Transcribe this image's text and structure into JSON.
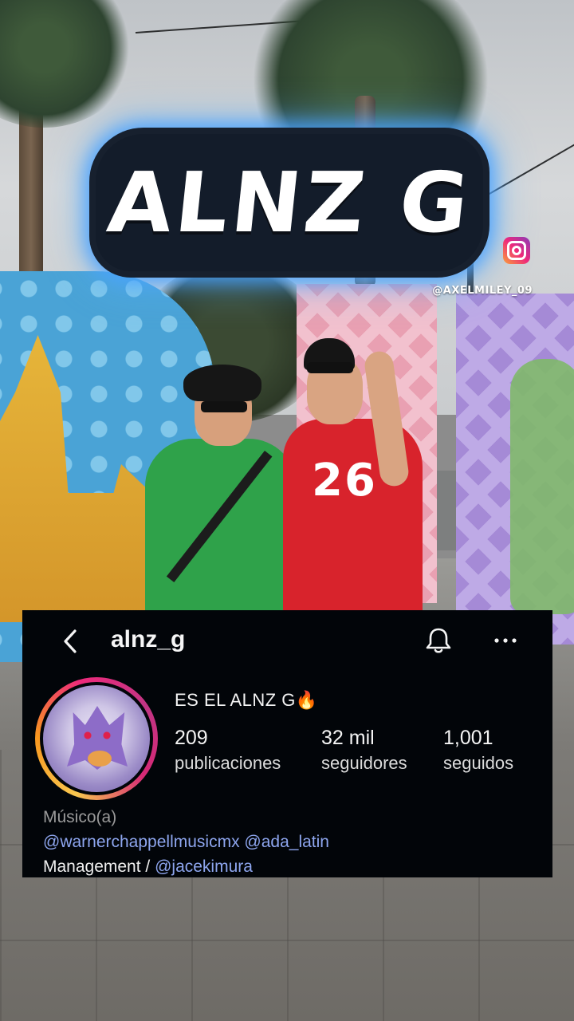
{
  "overlay": {
    "title": "ALNZ G",
    "watermark": "@AXELMILEY_09"
  },
  "shirt_number": "26",
  "profile": {
    "username": "alnz_g",
    "display_name": "ES EL ALNZ G🔥",
    "stats": {
      "posts": {
        "value": "209",
        "label": "publicaciones"
      },
      "followers": {
        "value": "32 mil",
        "label": "seguidores"
      },
      "following": {
        "value": "1,001",
        "label": "seguidos"
      }
    },
    "bio": {
      "category": "Músico(a)",
      "mention_1": "@warnerchappellmusicmx",
      "mention_2": "@ada_latin",
      "line3_prefix": "Management / ",
      "mention_3": "@jacekimura"
    }
  },
  "icons": {
    "back": "chevron-left-icon",
    "notifications": "bell-icon",
    "more": "more-horizontal-icon",
    "instagram": "instagram-icon"
  },
  "colors": {
    "card_background": "#020509",
    "link": "#8ea6ef",
    "title_glow": "#46a0ff"
  }
}
